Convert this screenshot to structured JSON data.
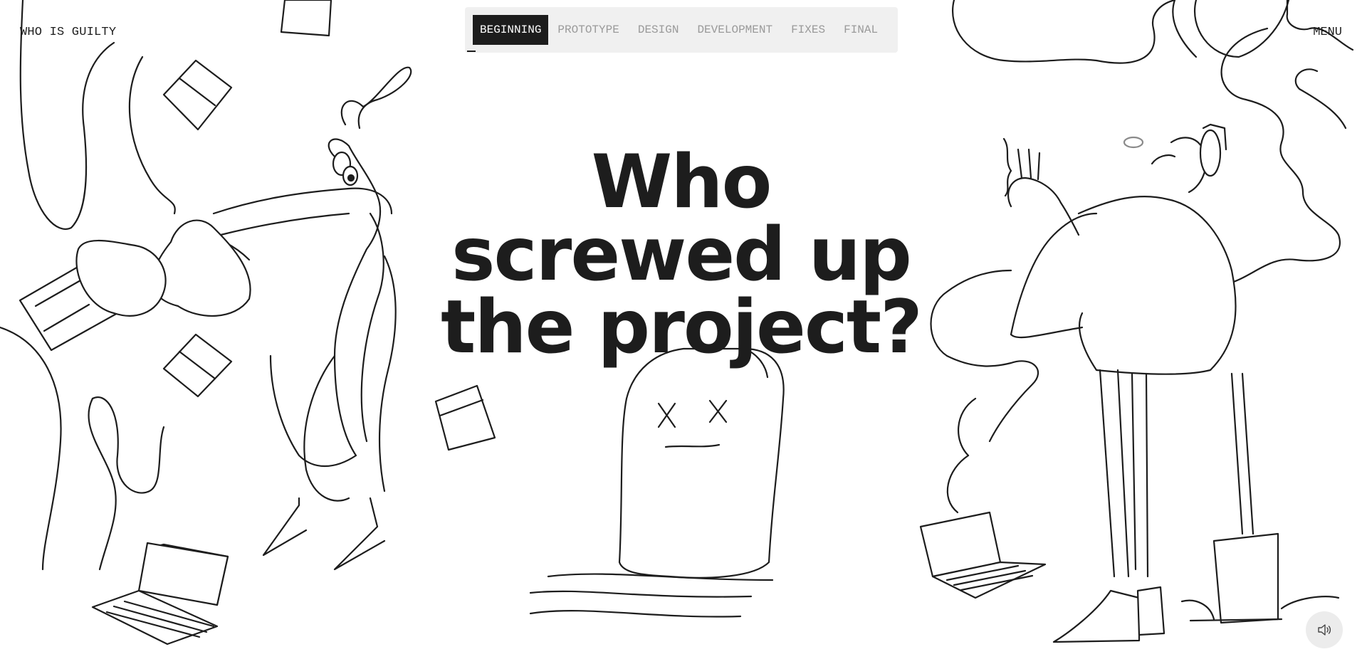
{
  "header": {
    "logo": "WHO IS GUILTY",
    "menu_label": "MENU"
  },
  "stages": [
    {
      "label": "BEGINNING",
      "active": true
    },
    {
      "label": "PROTOTYPE",
      "active": false
    },
    {
      "label": "DESIGN",
      "active": false
    },
    {
      "label": "DEVELOPMENT",
      "active": false
    },
    {
      "label": "FIXES",
      "active": false
    },
    {
      "label": "FINAL",
      "active": false
    }
  ],
  "hero": {
    "line1": "Who",
    "line2": "screwed up",
    "line3": "the project?"
  },
  "controls": {
    "sound_icon": "speaker-icon"
  },
  "colors": {
    "ink": "#1d1d1d",
    "tab_bar": "#f0f0f0",
    "tab_inactive": "#9a9a9a",
    "sound_button": "#ececec"
  }
}
